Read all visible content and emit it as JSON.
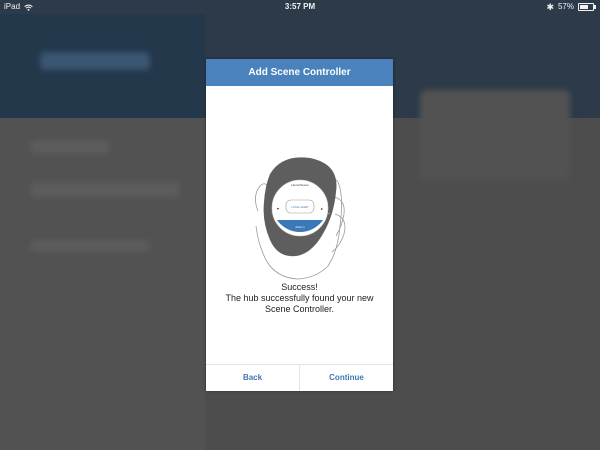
{
  "status_bar": {
    "device": "iPad",
    "time": "3:57 PM",
    "battery": "57%",
    "wifi_icon": "wifi-icon",
    "bluetooth_icon": "bluetooth-icon"
  },
  "modal": {
    "title": "Add Scene Controller",
    "message_line1": "Success!",
    "message_line2": "The hub successfully found your new Scene Controller.",
    "back_label": "Back",
    "continue_label": "Continue",
    "accent_color": "#4a82bd"
  },
  "illustration": {
    "icon": "scene-controller-in-hand-illustration",
    "top_label": "Home/Scene",
    "center_label": "LOCAL ALERT",
    "bottom_label": "Action 1"
  }
}
